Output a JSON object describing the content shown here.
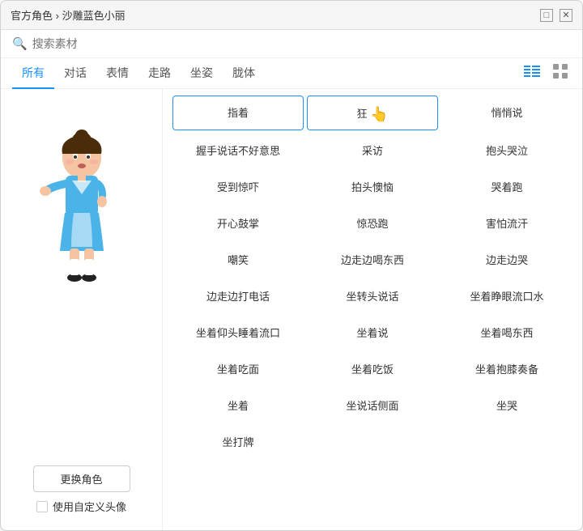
{
  "window": {
    "title": "官方角色 › 沙雕蓝色小丽",
    "breadcrumb_sep": " › ",
    "breadcrumb_part1": "官方角色",
    "breadcrumb_part2": "沙雕蓝色小丽",
    "close_label": "✕",
    "minimize_label": "□"
  },
  "search": {
    "placeholder": "搜索素材",
    "icon": "🔍"
  },
  "tabs": [
    {
      "id": "all",
      "label": "所有",
      "active": true
    },
    {
      "id": "dialogue",
      "label": "对话"
    },
    {
      "id": "expression",
      "label": "表情"
    },
    {
      "id": "walk",
      "label": "走路"
    },
    {
      "id": "posture",
      "label": "坐姿"
    },
    {
      "id": "body",
      "label": "胧体"
    }
  ],
  "view_modes": [
    {
      "id": "list",
      "label": "≡☰",
      "active": true
    },
    {
      "id": "grid",
      "label": "⊞",
      "active": false
    }
  ],
  "actions": [
    {
      "id": "a1",
      "label": "指着",
      "highlighted": true
    },
    {
      "id": "a2",
      "label": "狂",
      "highlighted": true
    },
    {
      "id": "a3",
      "label": "悄悄说"
    },
    {
      "id": "a4",
      "label": "握手说话不好意思"
    },
    {
      "id": "a5",
      "label": "采访"
    },
    {
      "id": "a6",
      "label": "抱头哭泣"
    },
    {
      "id": "a7",
      "label": "受到惊吓"
    },
    {
      "id": "a8",
      "label": "拍头懊恼"
    },
    {
      "id": "a9",
      "label": "哭着跑"
    },
    {
      "id": "a10",
      "label": "开心鼓掌"
    },
    {
      "id": "a11",
      "label": "惊恐跑"
    },
    {
      "id": "a12",
      "label": "害怕流汗"
    },
    {
      "id": "a13",
      "label": "嘲笑"
    },
    {
      "id": "a14",
      "label": "边走边喝东西"
    },
    {
      "id": "a15",
      "label": "边走边哭"
    },
    {
      "id": "a16",
      "label": "边走边打电话"
    },
    {
      "id": "a17",
      "label": "坐转头说话"
    },
    {
      "id": "a18",
      "label": "坐着睁眼流口水"
    },
    {
      "id": "a19",
      "label": "坐着仰头睡着流口"
    },
    {
      "id": "a20",
      "label": "坐着说"
    },
    {
      "id": "a21",
      "label": "坐着喝东西"
    },
    {
      "id": "a22",
      "label": "坐着吃面"
    },
    {
      "id": "a23",
      "label": "坐着吃饭"
    },
    {
      "id": "a24",
      "label": "坐着抱膝奏备"
    },
    {
      "id": "a25",
      "label": "坐着"
    },
    {
      "id": "a26",
      "label": "坐说话侧面"
    },
    {
      "id": "a27",
      "label": "坐哭"
    },
    {
      "id": "a28",
      "label": "坐打牌"
    }
  ],
  "left_panel": {
    "change_role_label": "更换角色",
    "custom_avatar_label": "使用自定义头像"
  }
}
